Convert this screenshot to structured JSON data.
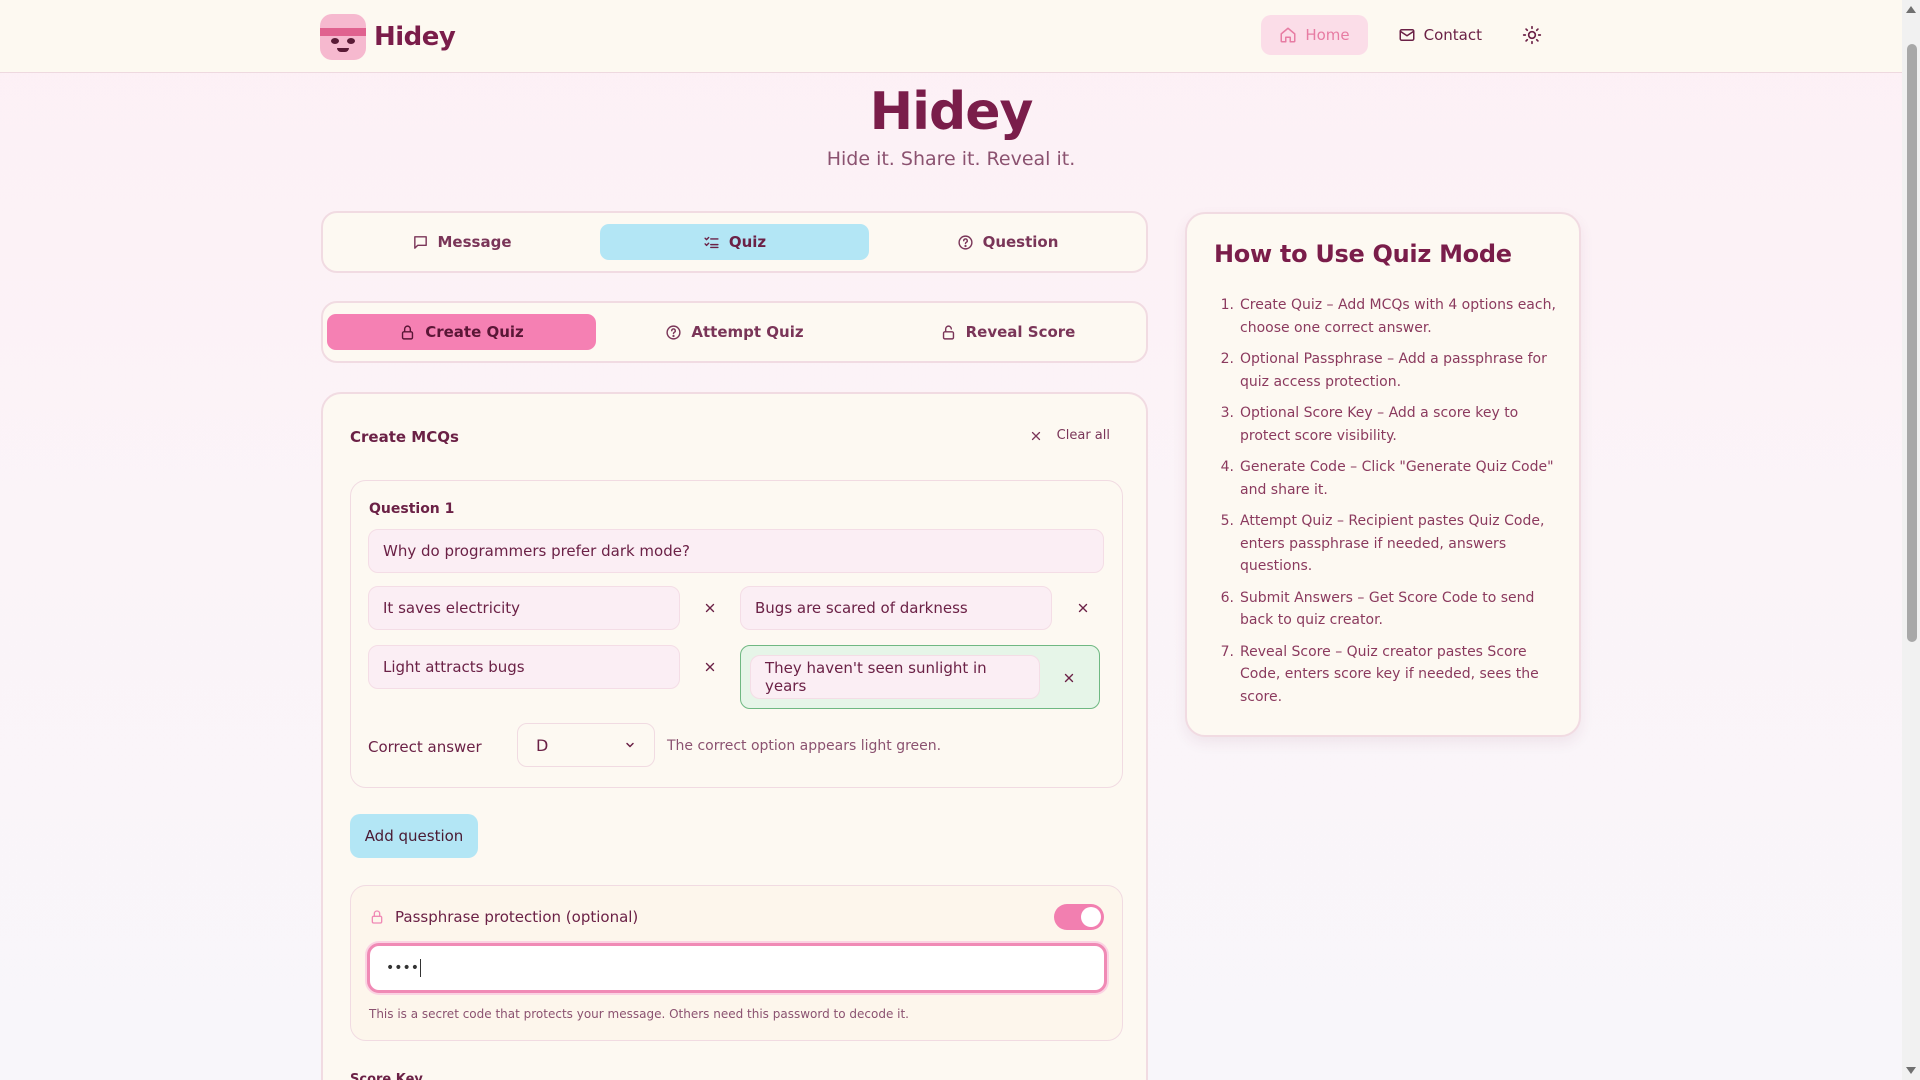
{
  "header": {
    "brand": "Hidey",
    "nav": {
      "home": "Home",
      "contact": "Contact"
    }
  },
  "hero": {
    "title": "Hidey",
    "subtitle": "Hide it. Share it. Reveal it."
  },
  "mode_tabs": [
    {
      "label": "Message",
      "icon": "message-icon"
    },
    {
      "label": "Quiz",
      "icon": "checklist-icon",
      "active": true
    },
    {
      "label": "Question",
      "icon": "question-circle-icon"
    }
  ],
  "quiz_tabs": [
    {
      "label": "Create Quiz",
      "icon": "lock-icon",
      "active": true
    },
    {
      "label": "Attempt Quiz",
      "icon": "question-circle-icon"
    },
    {
      "label": "Reveal Score",
      "icon": "unlock-icon"
    }
  ],
  "create": {
    "title": "Create MCQs",
    "clear_all": "Clear all",
    "questions": [
      {
        "label": "Question 1",
        "text": "Why do programmers prefer dark mode?",
        "options": [
          "It saves electricity",
          "Bugs are scared of darkness",
          "Light attracts bugs",
          "They haven't seen sunlight in years"
        ],
        "correct_label": "Correct answer",
        "correct_value": "D",
        "correct_hint": "The correct option appears light green."
      }
    ],
    "add_question": "Add question",
    "passphrase": {
      "label": "Passphrase protection (optional)",
      "enabled": true,
      "value": "••••",
      "hint": "This is a secret code that protects your message. Others need this password to decode it."
    },
    "next_section_label": "Score Key"
  },
  "side": {
    "title": "How to Use Quiz Mode",
    "steps": [
      "Create Quiz – Add MCQs with 4 options each, choose one correct answer.",
      "Optional Passphrase – Add a passphrase for quiz access protection.",
      "Optional Score Key – Add a score key to protect score visibility.",
      "Generate Code – Click \"Generate Quiz Code\" and share it.",
      "Attempt Quiz – Recipient pastes Quiz Code, enters passphrase if needed, answers questions.",
      "Submit Answers – Get Score Code to send back to quiz creator.",
      "Reveal Score – Quiz creator pastes Score Code, enters score key if needed, sees the score."
    ]
  },
  "colors": {
    "brand": "#7a1d4a",
    "pink_accent": "#f580b3",
    "blue_accent": "#b3e6f5",
    "correct_green": "#e6f5e8",
    "background": "#fdf0f5"
  }
}
